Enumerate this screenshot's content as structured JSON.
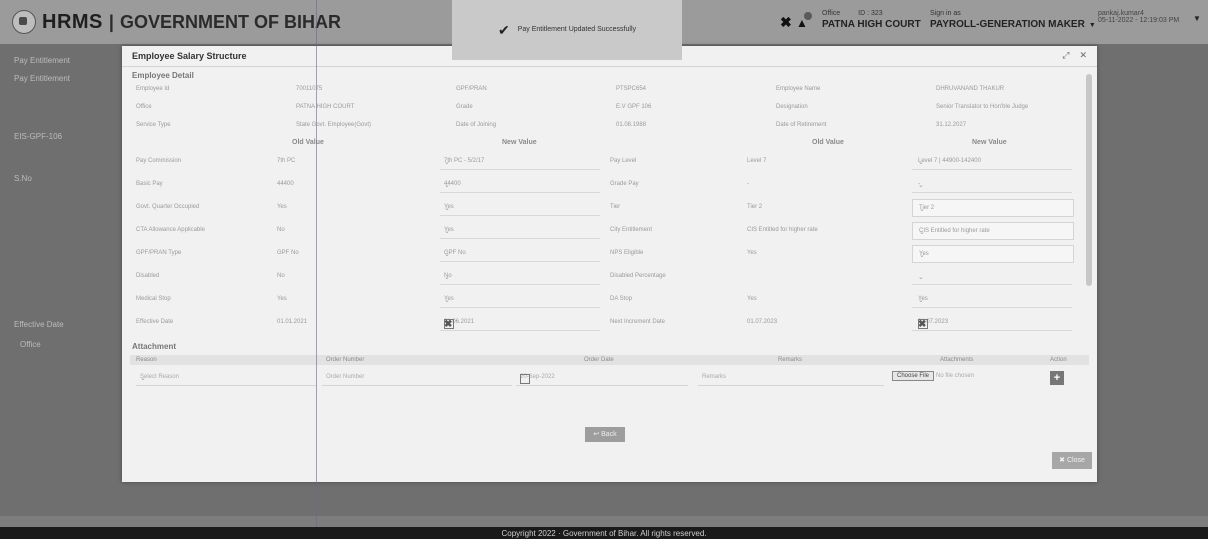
{
  "header": {
    "brand_hrms": "HRMS",
    "brand_separator": "|",
    "brand_gov": "GOVERNMENT OF BIHAR",
    "toast_message": "Pay Entitlement Updated Successfully",
    "office_label": "Office",
    "office_id": "ID : 323",
    "office_name": "PATNA HIGH COURT",
    "signin_label": "Sign in as",
    "signin_role": "PAYROLL-GENERATION MAKER",
    "user_name": "pankaj.kumar4",
    "user_datetime": "05-11-2022 - 12:19:03 PM"
  },
  "background": {
    "side_items": [
      "Pay Entitlement",
      "Pay Entitlement",
      "EIS-GPF-106",
      "S.No",
      "Effective Date",
      "Office"
    ]
  },
  "modal": {
    "title": "Employee Salary Structure",
    "section_detail": "Employee Detail",
    "detail_rows": [
      [
        "Employee Id",
        "70011075",
        "GPF/PRAN",
        "PTSPC654",
        "Employee Name",
        "DHRUVANAND THAKUR"
      ],
      [
        "Office",
        "PATNA HIGH COURT",
        "Grade",
        "E.V GPF 106",
        "Designation",
        "Senior Translator to Hon'ble Judge"
      ],
      [
        "Service Type",
        "State Govt. Employee(Govt)",
        "Date of Joining",
        "01.08.1988",
        "Date of Retirement",
        "31.12.2027"
      ]
    ],
    "col_headers": {
      "old_value": "Old Value",
      "new_value": "New Value"
    },
    "compare_rows": [
      {
        "l1": "Pay Commission",
        "o1": "7th PC",
        "n1": "7th PC - 5/2/17",
        "l2": "Pay Level",
        "o2": "Level 7",
        "n2": "Level 7 | 44900-142400",
        "boxed": false
      },
      {
        "l1": "Basic Pay",
        "o1": "44400",
        "n1": "44400",
        "l2": "Grade Pay",
        "o2": "-",
        "n2": "-",
        "boxed": false
      },
      {
        "l1": "Govt. Quarter Occupied",
        "o1": "Yes",
        "n1": "Yes",
        "l2": "Tier",
        "o2": "Tier 2",
        "n2": "Tier 2",
        "boxed": true
      },
      {
        "l1": "CTA Allowance Applicable",
        "o1": "No",
        "n1": "Yes",
        "l2": "City Entitlement",
        "o2": "CIS Entitled for higher rate",
        "n2": "CIS Entitled for higher rate",
        "boxed": true
      },
      {
        "l1": "GPF/PRAN Type",
        "o1": "GPF No",
        "n1": "GPF No",
        "l2": "NPS Eligible",
        "o2": "Yes",
        "n2": "Yes",
        "boxed": true
      },
      {
        "l1": "Disabled",
        "o1": "No",
        "n1": "No",
        "l2": "Disabled Percentage",
        "o2": "",
        "n2": "",
        "boxed": false
      },
      {
        "l1": "Medical Stop",
        "o1": "Yes",
        "n1": "Yes",
        "l2": "DA Stop",
        "o2": "Yes",
        "n2": "Yes",
        "boxed": false
      }
    ],
    "effective": {
      "label": "Effective Date",
      "old": "01.01.2021",
      "new": "01.06.2021",
      "label2": "Next Increment Date",
      "old2": "01.07.2023",
      "new2": "01.07.2023"
    },
    "section_attachment": "Attachment",
    "attach_headers": [
      "Reason",
      "Order Number",
      "Order Date",
      "Remarks",
      "Attachments",
      "Action"
    ],
    "attach_placeholders": {
      "reason": "Select Reason",
      "order_number": "Order Number",
      "order_date": "20-Sep-2022",
      "remarks": "Remarks",
      "choose_file": "Choose File",
      "no_file": "No file chosen",
      "add": "+"
    },
    "back_label": "Back",
    "close_label": "Close"
  },
  "footer": {
    "copyright": "Copyright 2022 · Government of Bihar. All rights reserved."
  }
}
